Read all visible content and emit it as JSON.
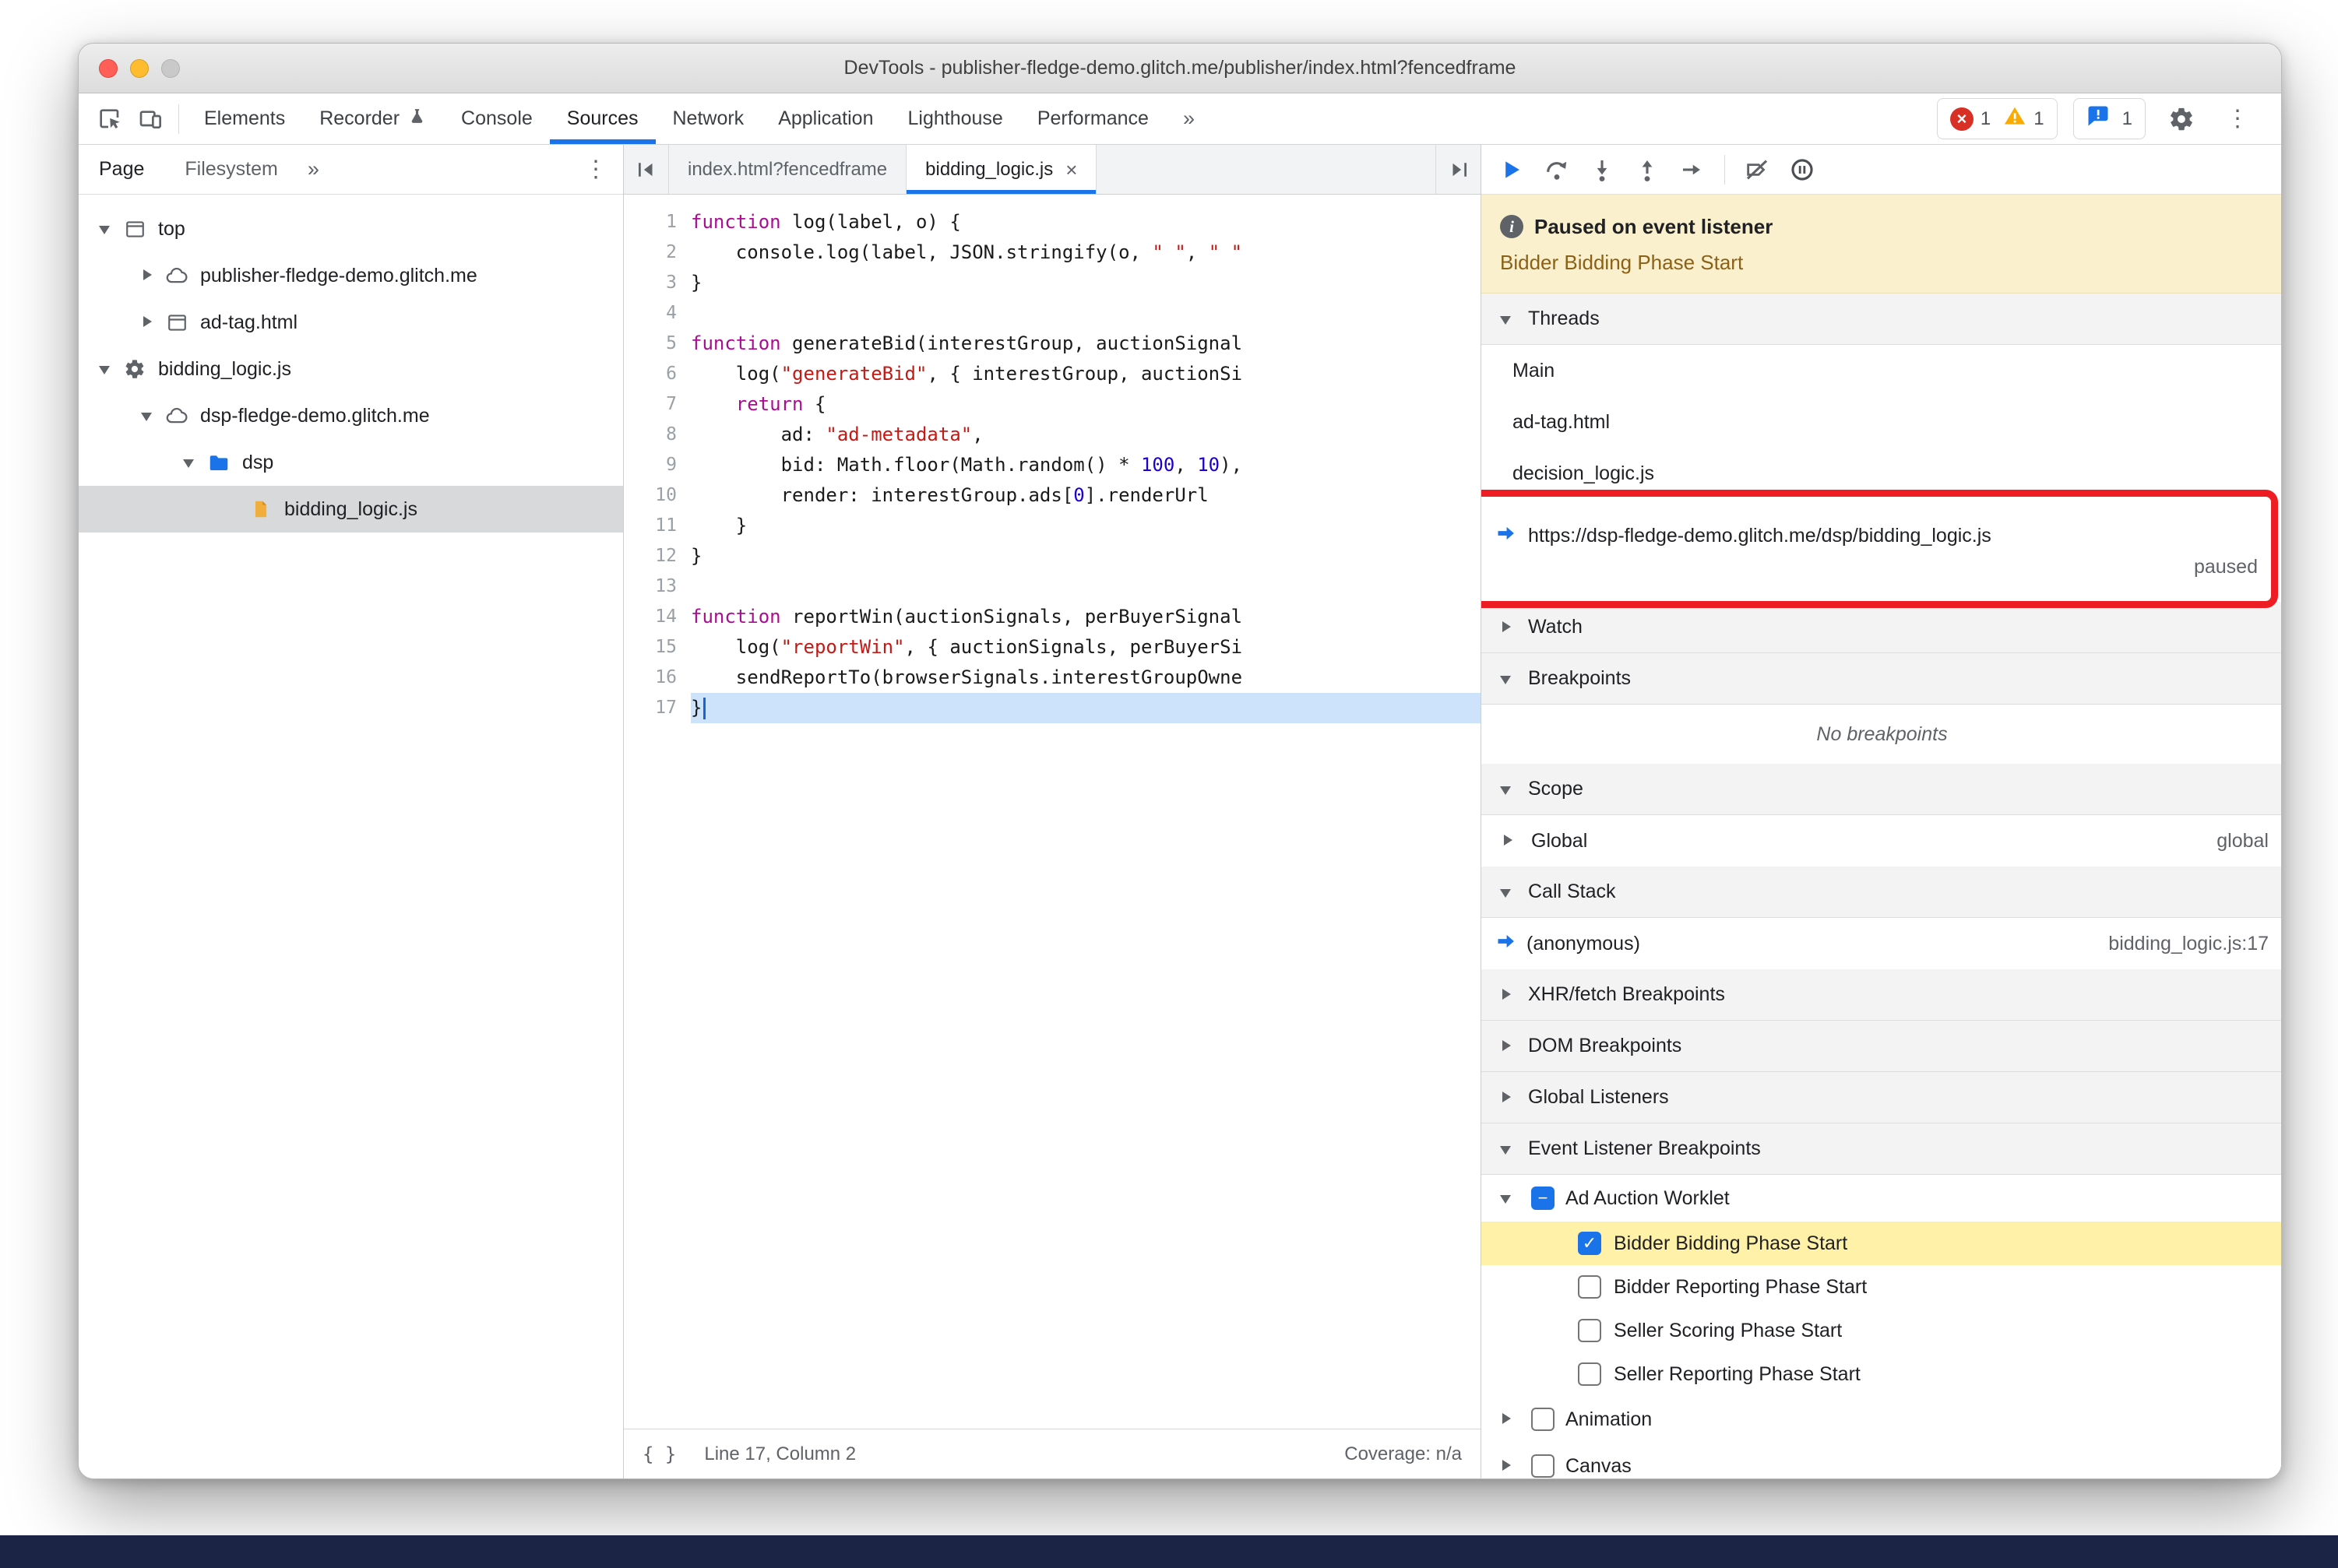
{
  "window_title": "DevTools - publisher-fledge-demo.glitch.me/publisher/index.html?fencedframe",
  "toolbar": {
    "tabs": [
      {
        "label": "Elements"
      },
      {
        "label": "Recorder",
        "icon": "flask-icon"
      },
      {
        "label": "Console"
      },
      {
        "label": "Sources",
        "selected": true
      },
      {
        "label": "Network"
      },
      {
        "label": "Application"
      },
      {
        "label": "Lighthouse"
      },
      {
        "label": "Performance"
      }
    ],
    "more_label": "»",
    "errors": "1",
    "warnings": "1",
    "issues": "1"
  },
  "sidebar": {
    "tabs": [
      {
        "label": "Page",
        "selected": true
      },
      {
        "label": "Filesystem"
      }
    ],
    "more_label": "»",
    "tree": [
      {
        "label": "top",
        "icon": "frame-icon",
        "depth": 0,
        "exp": "open"
      },
      {
        "label": "publisher-fledge-demo.glitch.me",
        "icon": "cloud-icon",
        "depth": 1,
        "exp": "closed"
      },
      {
        "label": "ad-tag.html",
        "icon": "frame-icon",
        "depth": 1,
        "exp": "closed"
      },
      {
        "label": "bidding_logic.js",
        "icon": "gear-icon",
        "depth": 0,
        "exp": "open"
      },
      {
        "label": "dsp-fledge-demo.glitch.me",
        "icon": "cloud-icon",
        "depth": 1,
        "exp": "open"
      },
      {
        "label": "dsp",
        "icon": "folder-icon",
        "depth": 2,
        "exp": "open"
      },
      {
        "label": "bidding_logic.js",
        "icon": "js-file-icon",
        "depth": 3,
        "exp": "none",
        "selected": true
      }
    ]
  },
  "editor": {
    "tabs": [
      {
        "label": "index.html?fencedframe"
      },
      {
        "label": "bidding_logic.js",
        "active": true,
        "closable": true
      }
    ],
    "status_line": "Line 17, Column 2",
    "coverage": "Coverage: n/a",
    "lines": [
      {
        "n": 1,
        "seg": [
          [
            "k",
            "function"
          ],
          [
            "d",
            " log(label, o) {"
          ]
        ]
      },
      {
        "n": 2,
        "seg": [
          [
            "d",
            "    console.log(label, JSON.stringify(o, "
          ],
          [
            "s",
            "\" \""
          ],
          [
            "d",
            ", "
          ],
          [
            "s",
            "\" \""
          ]
        ]
      },
      {
        "n": 3,
        "seg": [
          [
            "d",
            "}"
          ]
        ]
      },
      {
        "n": 4,
        "seg": []
      },
      {
        "n": 5,
        "seg": [
          [
            "k",
            "function"
          ],
          [
            "d",
            " generateBid(interestGroup, auctionSignal"
          ]
        ]
      },
      {
        "n": 6,
        "seg": [
          [
            "d",
            "    log("
          ],
          [
            "s",
            "\"generateBid\""
          ],
          [
            "d",
            ", { interestGroup, auctionSi"
          ]
        ]
      },
      {
        "n": 7,
        "seg": [
          [
            "d",
            "    "
          ],
          [
            "k",
            "return"
          ],
          [
            "d",
            " {"
          ]
        ]
      },
      {
        "n": 8,
        "seg": [
          [
            "d",
            "        ad: "
          ],
          [
            "s",
            "\"ad-metadata\""
          ],
          [
            "d",
            ","
          ]
        ]
      },
      {
        "n": 9,
        "seg": [
          [
            "d",
            "        bid: Math.floor(Math.random() * "
          ],
          [
            "n",
            "100"
          ],
          [
            "d",
            ", "
          ],
          [
            "n",
            "10"
          ],
          [
            "d",
            "),"
          ]
        ]
      },
      {
        "n": 10,
        "seg": [
          [
            "d",
            "        render: interestGroup.ads["
          ],
          [
            "n",
            "0"
          ],
          [
            "d",
            "].renderUrl"
          ]
        ]
      },
      {
        "n": 11,
        "seg": [
          [
            "d",
            "    }"
          ]
        ]
      },
      {
        "n": 12,
        "seg": [
          [
            "d",
            "}"
          ]
        ]
      },
      {
        "n": 13,
        "seg": []
      },
      {
        "n": 14,
        "seg": [
          [
            "k",
            "function"
          ],
          [
            "d",
            " reportWin(auctionSignals, perBuyerSignal"
          ]
        ]
      },
      {
        "n": 15,
        "seg": [
          [
            "d",
            "    log("
          ],
          [
            "s",
            "\"reportWin\""
          ],
          [
            "d",
            ", { auctionSignals, perBuyerSi"
          ]
        ]
      },
      {
        "n": 16,
        "seg": [
          [
            "d",
            "    sendReportTo(browserSignals.interestGroupOwne"
          ]
        ]
      },
      {
        "n": 17,
        "seg": [
          [
            "d",
            "}"
          ]
        ],
        "exec": true
      }
    ]
  },
  "debugger": {
    "paused_banner": {
      "title": "Paused on event listener",
      "subtitle": "Bidder Bidding Phase Start"
    },
    "sections": {
      "threads": "Threads",
      "watch": "Watch",
      "breakpoints": "Breakpoints",
      "scope": "Scope",
      "call_stack": "Call Stack",
      "xhr": "XHR/fetch Breakpoints",
      "dom": "DOM Breakpoints",
      "global_listeners": "Global Listeners",
      "elb": "Event Listener Breakpoints"
    },
    "threads": [
      {
        "label": "Main"
      },
      {
        "label": "ad-tag.html"
      },
      {
        "label": "decision_logic.js"
      },
      {
        "label": "https://dsp-fledge-demo.glitch.me/dsp/bidding_logic.js",
        "status": "paused",
        "current": true,
        "annotated": true
      }
    ],
    "breakpoints_empty": "No breakpoints",
    "scope_rows": [
      {
        "label": "Global",
        "value": "global"
      }
    ],
    "call_stack_rows": [
      {
        "label": "(anonymous)",
        "value": "bidding_logic.js:17",
        "current": true
      }
    ],
    "elb_groups": [
      {
        "label": "Ad Auction Worklet",
        "checkbox": "indeterminate",
        "exp": "open",
        "children": [
          {
            "label": "Bidder Bidding Phase Start",
            "checked": true,
            "highlight": true
          },
          {
            "label": "Bidder Reporting Phase Start",
            "checked": false
          },
          {
            "label": "Seller Scoring Phase Start",
            "checked": false
          },
          {
            "label": "Seller Reporting Phase Start",
            "checked": false
          }
        ]
      },
      {
        "label": "Animation",
        "checkbox": "unchecked",
        "exp": "closed",
        "children": []
      },
      {
        "label": "Canvas",
        "checkbox": "unchecked",
        "exp": "closed",
        "children": []
      }
    ]
  },
  "colors": {
    "accent": "#1a73e8",
    "error": "#d93025",
    "warning": "#f9ab00",
    "annotation": "#ee1d23",
    "exec_line": "#cde3fc",
    "elb_highlight": "#fff1a8"
  }
}
